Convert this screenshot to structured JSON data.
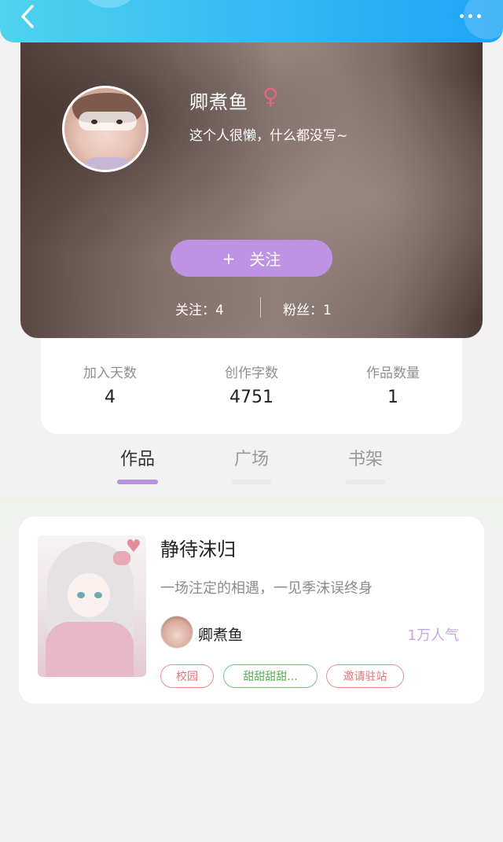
{
  "header": {
    "back_icon": "chevron-left-icon",
    "more_icon": "more-dots-icon"
  },
  "profile": {
    "name": "卿煮鱼",
    "gender_symbol": "♀",
    "gender_color": "#e4637f",
    "bio": "这个人很懒，什么都没写~",
    "follow_button_plus": "+",
    "follow_button_label": "关注",
    "follow_button_color": "#bf93e4",
    "following_text": "关注：4",
    "followers_text": "粉丝：1"
  },
  "stats": [
    {
      "label": "加入天数",
      "value": "4"
    },
    {
      "label": "创作字数",
      "value": "4751"
    },
    {
      "label": "作品数量",
      "value": "1"
    }
  ],
  "tabs": [
    {
      "label": "作品",
      "active": true
    },
    {
      "label": "广场",
      "active": false
    },
    {
      "label": "书架",
      "active": false
    }
  ],
  "works": [
    {
      "title": "静待沫归",
      "description": "一场注定的相遇，一见季沫误终身",
      "author": "卿煮鱼",
      "popularity": "1万人气",
      "tags": [
        "校园",
        "甜甜甜甜...",
        "邀请驻站"
      ]
    }
  ],
  "colors": {
    "accent": "#b792e0",
    "header_gradient_start": "#4fd3ee",
    "header_gradient_end": "#1ea5f6"
  }
}
